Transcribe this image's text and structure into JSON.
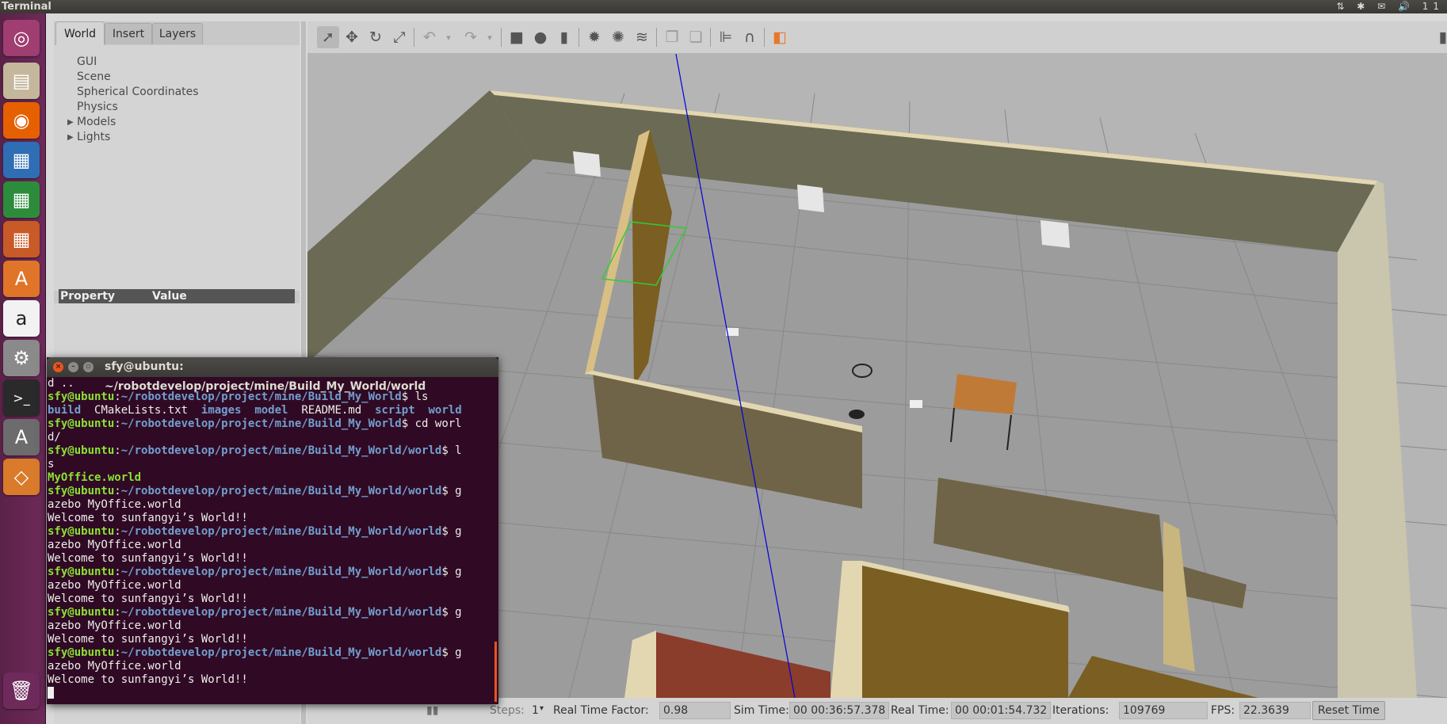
{
  "top_panel": {
    "app_title": "Terminal",
    "indicators": "⇅ ✱ ✉ 🔊 11"
  },
  "launcher": {
    "items": [
      {
        "name": "ubuntu-dash-icon",
        "glyph": "◎",
        "color": "#a03d71"
      },
      {
        "name": "files-icon",
        "glyph": "▤",
        "color": "#c4b79b"
      },
      {
        "name": "firefox-icon",
        "glyph": "◉",
        "color": "#e66000"
      },
      {
        "name": "writer-icon",
        "glyph": "▦",
        "color": "#2f6db4"
      },
      {
        "name": "calc-icon",
        "glyph": "▦",
        "color": "#2d8c3c"
      },
      {
        "name": "impress-icon",
        "glyph": "▦",
        "color": "#c85a28"
      },
      {
        "name": "software-center-icon",
        "glyph": "A",
        "color": "#e07429"
      },
      {
        "name": "amazon-icon",
        "glyph": "a",
        "color": "#f2f2f2"
      },
      {
        "name": "settings-icon",
        "glyph": "⚙",
        "color": "#8a8a8a"
      },
      {
        "name": "terminal-icon",
        "glyph": ">_",
        "color": "#2a2a2a"
      },
      {
        "name": "updater-icon",
        "glyph": "A",
        "color": "#6c6c6c"
      },
      {
        "name": "virtualbox-icon",
        "glyph": "◇",
        "color": "#d97b2a"
      },
      {
        "name": "trash-icon",
        "glyph": "🗑",
        "color": "#6e2a5a"
      }
    ]
  },
  "gazebo": {
    "tabs": [
      "World",
      "Insert",
      "Layers"
    ],
    "tree": [
      "GUI",
      "Scene",
      "Spherical Coordinates",
      "Physics",
      "Models",
      "Lights"
    ],
    "property_header": {
      "property": "Property",
      "value": "Value"
    },
    "bottom": {
      "steps_label": "Steps:",
      "steps_value": "1",
      "rtf_label": "Real Time Factor:",
      "rtf_value": "0.98",
      "sim_label": "Sim Time:",
      "sim_value": "00 00:36:57.378",
      "real_label": "Real Time:",
      "real_value": "00 00:01:54.732",
      "iter_label": "Iterations:",
      "iter_value": "109769",
      "fps_label": "FPS:",
      "fps_value": "22.3639",
      "reset_label": "Reset Time"
    }
  },
  "terminal": {
    "title": "sfy@ubuntu: ~/robotdevelop/project/mine/Build_My_World/world",
    "user": "sfy@ubuntu",
    "path_base": "~/robotdevelop/project/mine/Build_My_World",
    "path_world": "~/robotdevelop/project/mine/Build_My_World/world",
    "line0": "d ..",
    "cmd_ls": "$ ls",
    "ls_out": {
      "build": "build",
      "cmake": "CMakeLists.txt",
      "images": "images",
      "model": "model",
      "readme": "README.md",
      "script": "script",
      "world": "world"
    },
    "cmd_cd": "$ cd worl",
    "cd_wrap": "d/",
    "cmd_ls2": "$ l",
    "ls2_wrap": "s",
    "ls2_out": "MyOffice.world",
    "cmd_g": "$ g",
    "g_wrap": "azebo MyOffice.world",
    "welcome": "Welcome to sunfangyi’s World!!"
  }
}
